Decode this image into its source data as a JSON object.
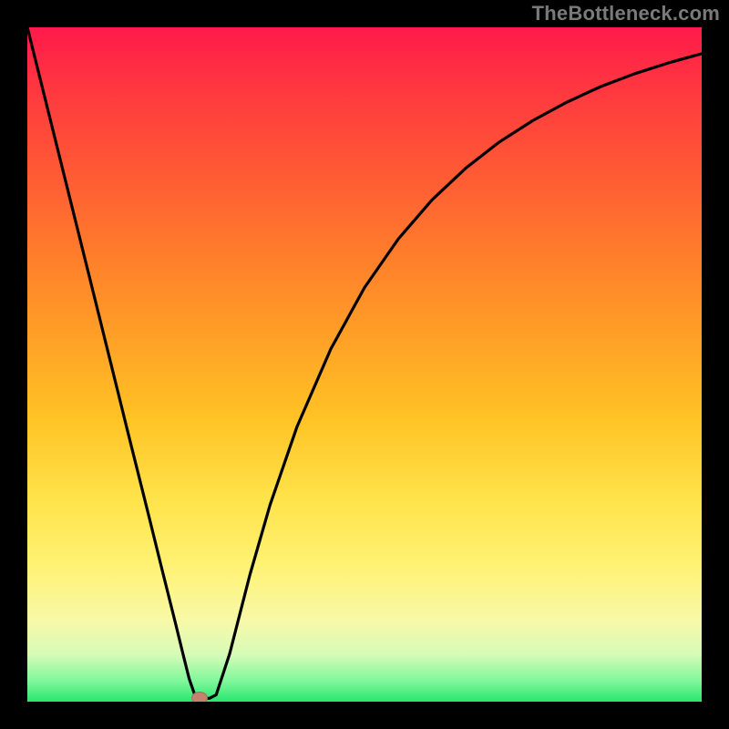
{
  "watermark": "TheBottleneck.com",
  "colors": {
    "background_border": "#000000",
    "curve_stroke": "#000000",
    "dot_fill": "#c6826f",
    "watermark_text": "#7a7a7a",
    "gradient_stops": [
      "#ff1a4a",
      "#ff3a3f",
      "#ff5b34",
      "#ff7e2b",
      "#ffa026",
      "#ffc325",
      "#ffe34a",
      "#fff275",
      "#f7f9a8",
      "#d7fbb7",
      "#7ef79a",
      "#29e66f"
    ]
  },
  "chart_data": {
    "type": "line",
    "title": "",
    "xlabel": "",
    "ylabel": "",
    "xlim": [
      0,
      100
    ],
    "ylim": [
      0,
      100
    ],
    "grid": false,
    "legend": false,
    "x": [
      0,
      5,
      10,
      15,
      18,
      20,
      22,
      23,
      24,
      25,
      26,
      27,
      28,
      30,
      33,
      36,
      40,
      45,
      50,
      55,
      60,
      65,
      70,
      75,
      80,
      85,
      90,
      95,
      100
    ],
    "values": [
      100,
      79.9,
      59.8,
      39.6,
      27.6,
      19.5,
      11.5,
      7.4,
      3.4,
      0.5,
      0.5,
      0.5,
      1.0,
      7.1,
      18.8,
      29.2,
      40.8,
      52.3,
      61.4,
      68.6,
      74.4,
      79.1,
      83.0,
      86.2,
      88.9,
      91.2,
      93.1,
      94.7,
      96.1
    ],
    "minimum_point": {
      "x": 25.5,
      "y": 0.5
    },
    "notes": "V-shaped bottleneck curve; left branch descends linearly from top-left to minimum near x≈25; right branch rises with diminishing slope toward top-right, asymptoting below 100."
  }
}
